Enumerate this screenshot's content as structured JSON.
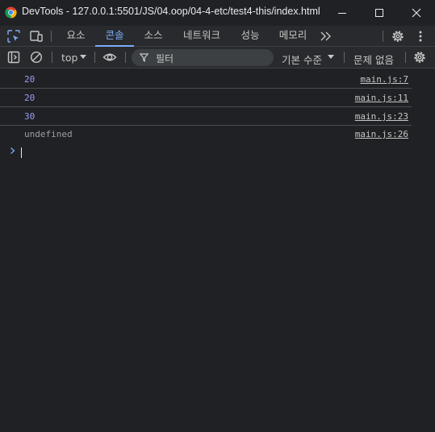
{
  "window": {
    "title": "DevTools - 127.0.0.1:5501/JS/04.oop/04-4-etc/test4-this/index.html"
  },
  "tabs": [
    {
      "label": "요소",
      "active": false
    },
    {
      "label": "콘솔",
      "active": true
    },
    {
      "label": "소스",
      "active": false
    },
    {
      "label": "네트워크",
      "active": false
    },
    {
      "label": "성능",
      "active": false
    },
    {
      "label": "메모리",
      "active": false
    }
  ],
  "toolbar": {
    "context": "top",
    "filter_placeholder": "필터",
    "levels": "기본 수준",
    "issues": "문제 없음"
  },
  "console": {
    "messages": [
      {
        "text": "20",
        "source": "main.js:7",
        "kind": "number"
      },
      {
        "text": "20",
        "source": "main.js:11",
        "kind": "number"
      },
      {
        "text": "30",
        "source": "main.js:23",
        "kind": "number"
      },
      {
        "text": "undefined",
        "source": "main.js:26",
        "kind": "undefined"
      }
    ]
  },
  "colors": {
    "background": "#202124",
    "toolbar": "#292a2d",
    "accent": "#7cacf8",
    "number": "#9a9cf6",
    "undefined": "#9aa0a6"
  }
}
